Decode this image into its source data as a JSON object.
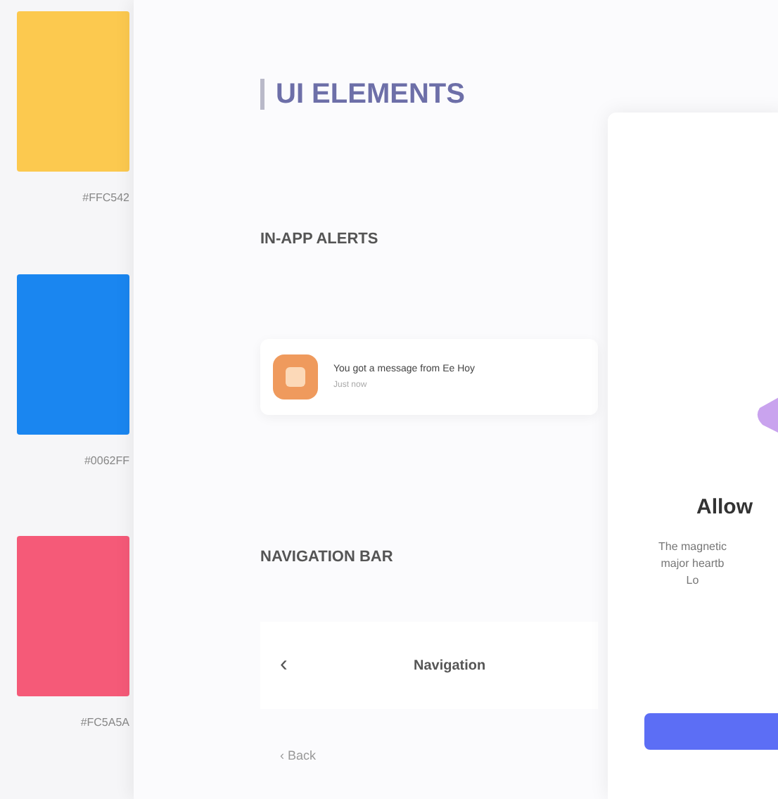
{
  "swatches": [
    {
      "color": "#fcc94f",
      "label": "#FFC542"
    },
    {
      "color": "#1a86f0",
      "label": "#0062FF"
    },
    {
      "color": "#f55a78",
      "label": "#FC5A5A"
    }
  ],
  "section_title": "UI ELEMENTS",
  "alerts": {
    "heading": "IN-APP ALERTS",
    "message": "You got a message from Ee Hoy",
    "time": "Just now"
  },
  "navigation_bar": {
    "heading": "NAVIGATION BAR",
    "back_glyph": "‹",
    "title": "Navigation",
    "back_link": "‹ Back"
  },
  "dialog": {
    "title": "Allow",
    "body": [
      "The magnetic",
      "major heartb",
      "Lo"
    ]
  }
}
